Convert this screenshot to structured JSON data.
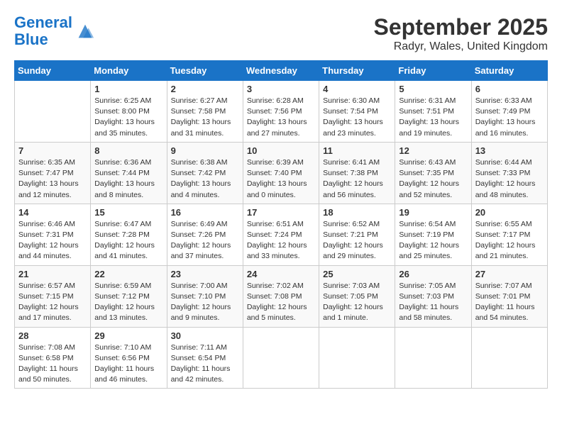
{
  "header": {
    "logo_line1": "General",
    "logo_line2": "Blue",
    "month_title": "September 2025",
    "location": "Radyr, Wales, United Kingdom"
  },
  "days_of_week": [
    "Sunday",
    "Monday",
    "Tuesday",
    "Wednesday",
    "Thursday",
    "Friday",
    "Saturday"
  ],
  "weeks": [
    [
      {
        "day": "",
        "info": ""
      },
      {
        "day": "1",
        "info": "Sunrise: 6:25 AM\nSunset: 8:00 PM\nDaylight: 13 hours\nand 35 minutes."
      },
      {
        "day": "2",
        "info": "Sunrise: 6:27 AM\nSunset: 7:58 PM\nDaylight: 13 hours\nand 31 minutes."
      },
      {
        "day": "3",
        "info": "Sunrise: 6:28 AM\nSunset: 7:56 PM\nDaylight: 13 hours\nand 27 minutes."
      },
      {
        "day": "4",
        "info": "Sunrise: 6:30 AM\nSunset: 7:54 PM\nDaylight: 13 hours\nand 23 minutes."
      },
      {
        "day": "5",
        "info": "Sunrise: 6:31 AM\nSunset: 7:51 PM\nDaylight: 13 hours\nand 19 minutes."
      },
      {
        "day": "6",
        "info": "Sunrise: 6:33 AM\nSunset: 7:49 PM\nDaylight: 13 hours\nand 16 minutes."
      }
    ],
    [
      {
        "day": "7",
        "info": "Sunrise: 6:35 AM\nSunset: 7:47 PM\nDaylight: 13 hours\nand 12 minutes."
      },
      {
        "day": "8",
        "info": "Sunrise: 6:36 AM\nSunset: 7:44 PM\nDaylight: 13 hours\nand 8 minutes."
      },
      {
        "day": "9",
        "info": "Sunrise: 6:38 AM\nSunset: 7:42 PM\nDaylight: 13 hours\nand 4 minutes."
      },
      {
        "day": "10",
        "info": "Sunrise: 6:39 AM\nSunset: 7:40 PM\nDaylight: 13 hours\nand 0 minutes."
      },
      {
        "day": "11",
        "info": "Sunrise: 6:41 AM\nSunset: 7:38 PM\nDaylight: 12 hours\nand 56 minutes."
      },
      {
        "day": "12",
        "info": "Sunrise: 6:43 AM\nSunset: 7:35 PM\nDaylight: 12 hours\nand 52 minutes."
      },
      {
        "day": "13",
        "info": "Sunrise: 6:44 AM\nSunset: 7:33 PM\nDaylight: 12 hours\nand 48 minutes."
      }
    ],
    [
      {
        "day": "14",
        "info": "Sunrise: 6:46 AM\nSunset: 7:31 PM\nDaylight: 12 hours\nand 44 minutes."
      },
      {
        "day": "15",
        "info": "Sunrise: 6:47 AM\nSunset: 7:28 PM\nDaylight: 12 hours\nand 41 minutes."
      },
      {
        "day": "16",
        "info": "Sunrise: 6:49 AM\nSunset: 7:26 PM\nDaylight: 12 hours\nand 37 minutes."
      },
      {
        "day": "17",
        "info": "Sunrise: 6:51 AM\nSunset: 7:24 PM\nDaylight: 12 hours\nand 33 minutes."
      },
      {
        "day": "18",
        "info": "Sunrise: 6:52 AM\nSunset: 7:21 PM\nDaylight: 12 hours\nand 29 minutes."
      },
      {
        "day": "19",
        "info": "Sunrise: 6:54 AM\nSunset: 7:19 PM\nDaylight: 12 hours\nand 25 minutes."
      },
      {
        "day": "20",
        "info": "Sunrise: 6:55 AM\nSunset: 7:17 PM\nDaylight: 12 hours\nand 21 minutes."
      }
    ],
    [
      {
        "day": "21",
        "info": "Sunrise: 6:57 AM\nSunset: 7:15 PM\nDaylight: 12 hours\nand 17 minutes."
      },
      {
        "day": "22",
        "info": "Sunrise: 6:59 AM\nSunset: 7:12 PM\nDaylight: 12 hours\nand 13 minutes."
      },
      {
        "day": "23",
        "info": "Sunrise: 7:00 AM\nSunset: 7:10 PM\nDaylight: 12 hours\nand 9 minutes."
      },
      {
        "day": "24",
        "info": "Sunrise: 7:02 AM\nSunset: 7:08 PM\nDaylight: 12 hours\nand 5 minutes."
      },
      {
        "day": "25",
        "info": "Sunrise: 7:03 AM\nSunset: 7:05 PM\nDaylight: 12 hours\nand 1 minute."
      },
      {
        "day": "26",
        "info": "Sunrise: 7:05 AM\nSunset: 7:03 PM\nDaylight: 11 hours\nand 58 minutes."
      },
      {
        "day": "27",
        "info": "Sunrise: 7:07 AM\nSunset: 7:01 PM\nDaylight: 11 hours\nand 54 minutes."
      }
    ],
    [
      {
        "day": "28",
        "info": "Sunrise: 7:08 AM\nSunset: 6:58 PM\nDaylight: 11 hours\nand 50 minutes."
      },
      {
        "day": "29",
        "info": "Sunrise: 7:10 AM\nSunset: 6:56 PM\nDaylight: 11 hours\nand 46 minutes."
      },
      {
        "day": "30",
        "info": "Sunrise: 7:11 AM\nSunset: 6:54 PM\nDaylight: 11 hours\nand 42 minutes."
      },
      {
        "day": "",
        "info": ""
      },
      {
        "day": "",
        "info": ""
      },
      {
        "day": "",
        "info": ""
      },
      {
        "day": "",
        "info": ""
      }
    ]
  ]
}
